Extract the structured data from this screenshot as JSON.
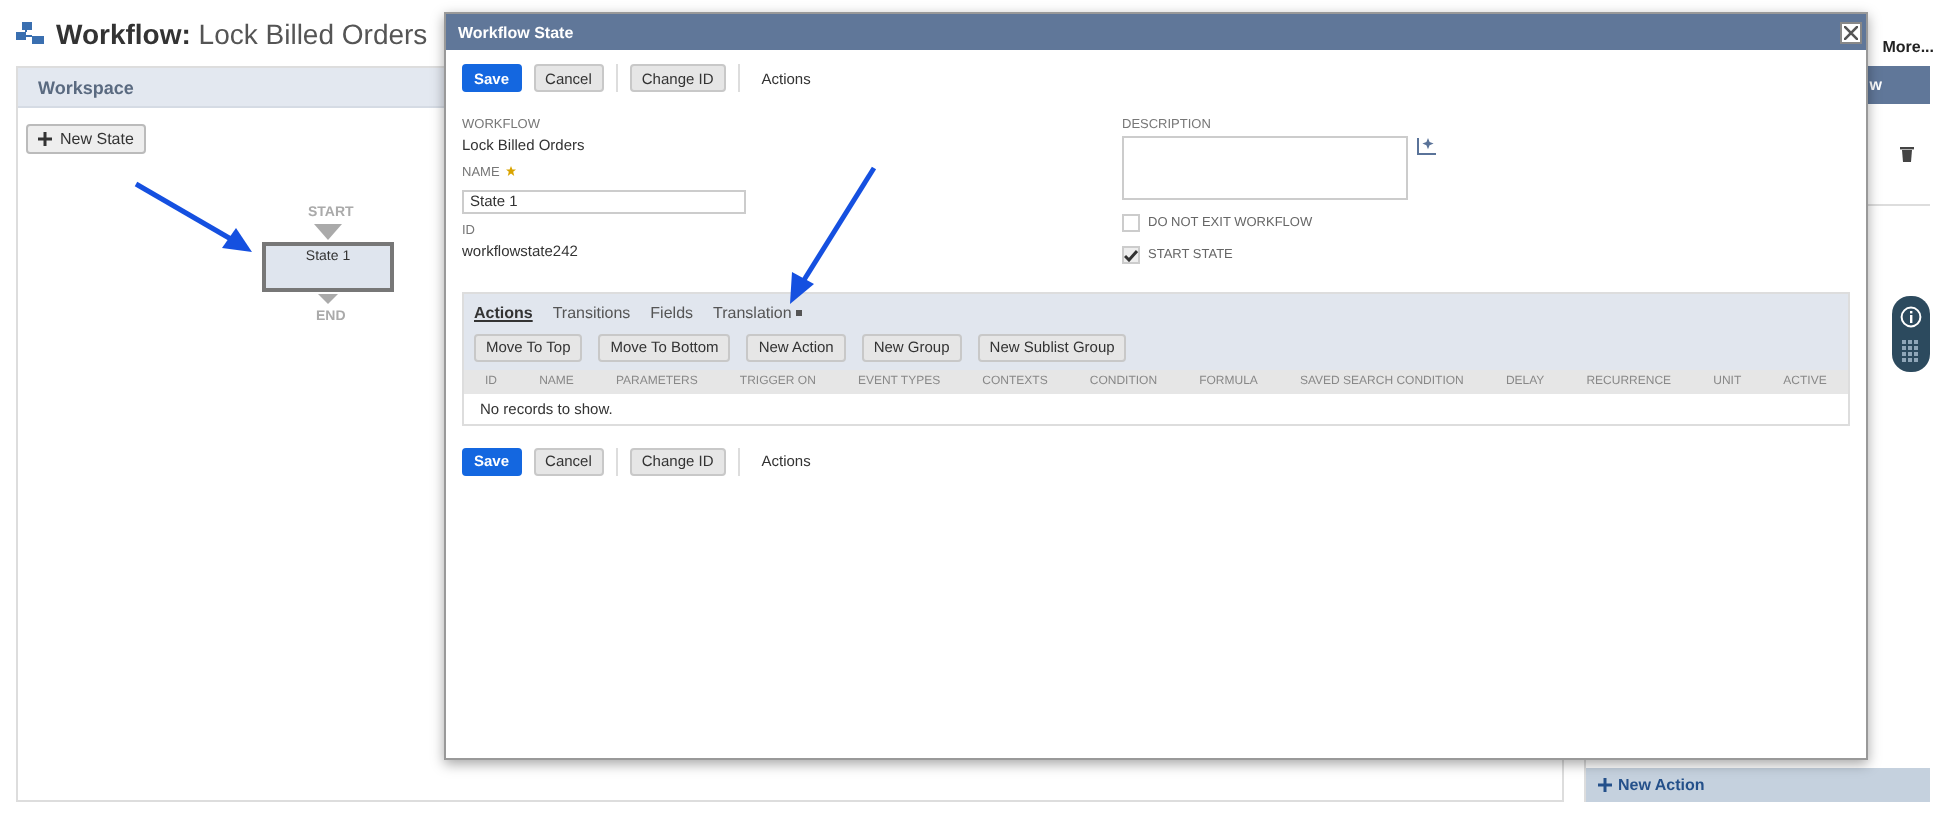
{
  "page": {
    "title_prefix": "Workflow:",
    "title": "Lock Billed Orders",
    "more_link": "More..."
  },
  "workspace": {
    "title": "Workspace",
    "new_state_button": "New State",
    "start_label": "START",
    "end_label": "END",
    "states": [
      {
        "name": "State 1",
        "selected": true
      }
    ]
  },
  "right_panel": {
    "header": "w",
    "new_action_button": "New Action"
  },
  "dialog": {
    "title": "Workflow State",
    "toolbar": [
      {
        "label": "Save",
        "kind": "primary"
      },
      {
        "label": "Cancel",
        "kind": "secondary"
      },
      {
        "label": "Change ID",
        "kind": "secondary",
        "separated": true
      },
      {
        "label": "Actions",
        "kind": "menu",
        "separated": true
      }
    ],
    "workflow": {
      "label": "WORKFLOW",
      "value": "Lock Billed Orders"
    },
    "name": {
      "label": "NAME",
      "value": "State 1",
      "required": true
    },
    "id": {
      "label": "ID",
      "value": "workflowstate242"
    },
    "description": {
      "label": "DESCRIPTION"
    },
    "checkboxes": [
      {
        "label": "DO NOT EXIT WORKFLOW",
        "checked": false
      },
      {
        "label": "START STATE",
        "checked": true
      }
    ],
    "sublist": {
      "tabs": [
        {
          "label": "Actions",
          "selected": true
        },
        {
          "label": "Transitions",
          "selected": false
        },
        {
          "label": "Fields",
          "selected": false
        },
        {
          "label": "Translation",
          "selected": false,
          "has_menu": true
        }
      ],
      "buttons": [
        "Move To Top",
        "Move To Bottom",
        "New Action",
        "New Group",
        "New Sublist Group"
      ],
      "columns": [
        "ID",
        "NAME",
        "PARAMETERS",
        "TRIGGER ON",
        "EVENT TYPES",
        "CONTEXTS",
        "CONDITION",
        "FORMULA",
        "SAVED SEARCH CONDITION",
        "DELAY",
        "RECURRENCE",
        "UNIT",
        "ACTIVE"
      ],
      "empty_message": "No records to show."
    },
    "bottom_toolbar": [
      {
        "label": "Save",
        "kind": "primary"
      },
      {
        "label": "Cancel",
        "kind": "secondary"
      },
      {
        "label": "Change ID",
        "kind": "secondary",
        "separated": true
      },
      {
        "label": "Actions",
        "kind": "menu",
        "separated": true
      }
    ]
  }
}
